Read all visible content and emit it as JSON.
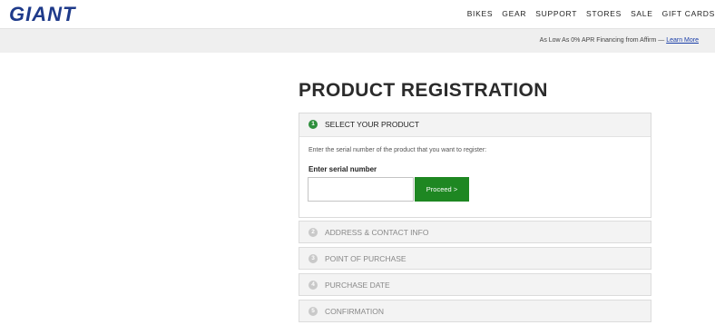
{
  "header": {
    "logo": "GIANT",
    "nav": [
      "BIKES",
      "GEAR",
      "SUPPORT",
      "STORES",
      "SALE",
      "GIFT CARDS"
    ]
  },
  "promo": {
    "text": "As Low As 0% APR Financing from Affirm — ",
    "link": "Learn More"
  },
  "page": {
    "title": "PRODUCT REGISTRATION"
  },
  "step1": {
    "number": "1",
    "title": "SELECT YOUR PRODUCT",
    "instruction": "Enter the serial number of the product that you want to register:",
    "serial_label": "Enter serial number",
    "serial_value": "",
    "serial_placeholder": "",
    "proceed_label": "Proceed >"
  },
  "steps": [
    {
      "number": "2",
      "label": "ADDRESS & CONTACT INFO"
    },
    {
      "number": "3",
      "label": "POINT OF PURCHASE"
    },
    {
      "number": "4",
      "label": "PURCHASE DATE"
    },
    {
      "number": "5",
      "label": "CONFIRMATION"
    }
  ],
  "colors": {
    "brand": "#1e3a8a",
    "accent_green": "#1e8722",
    "step_active": "#2e8f3c",
    "step_inactive": "#c9c9c9"
  }
}
